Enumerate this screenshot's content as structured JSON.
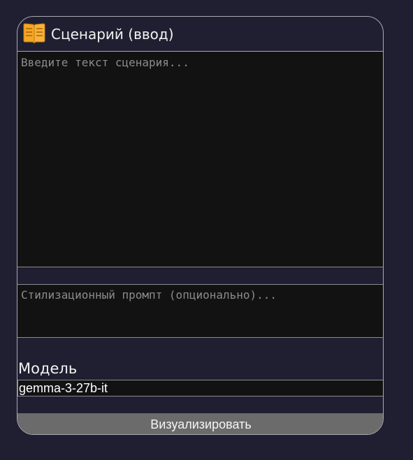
{
  "panel": {
    "title": "Сценарий (ввод)",
    "icon": "open-book-icon",
    "accent_color": "#f5a623"
  },
  "scenario": {
    "value": "",
    "placeholder": "Введите текст сценария..."
  },
  "style_prompt": {
    "value": "",
    "placeholder": "Стилизационный промпт (опционально)..."
  },
  "model": {
    "label": "Модель",
    "selected": "gemma-3-27b-it"
  },
  "actions": {
    "visualize_label": "Визуализировать"
  },
  "colors": {
    "background": "#201f31",
    "field_background": "#121212",
    "button_background": "#6b6b6b"
  }
}
